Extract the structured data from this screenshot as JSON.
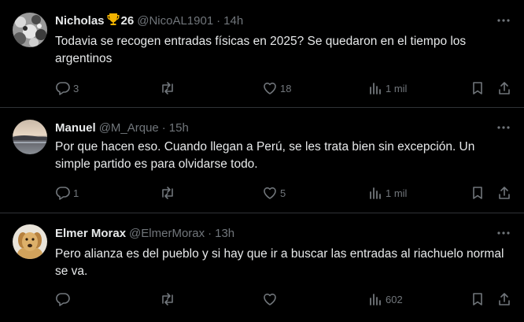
{
  "tweets": [
    {
      "name": "Nicholas",
      "name_suffix": "26",
      "trophy_icon": "trophy-emoji",
      "handle": "@NicoAL1901",
      "separator": "·",
      "time": "14h",
      "text": "Todavia se recogen entradas físicas en 2025? Se quedaron en el tiempo los argentinos",
      "replies": "3",
      "retweets": "",
      "likes": "18",
      "views": "1 mil"
    },
    {
      "name": "Manuel",
      "handle": "@M_Arque",
      "separator": "·",
      "time": "15h",
      "text": "Por que hacen eso. Cuando llegan a Perú, se les trata bien sin excepción. Un simple partido es para olvidarse todo.",
      "replies": "1",
      "retweets": "",
      "likes": "5",
      "views": "1 mil"
    },
    {
      "name": "Elmer Morax",
      "handle": "@ElmerMorax",
      "separator": "·",
      "time": "13h",
      "text": "Pero alianza es del pueblo y si hay que ir a buscar las entradas al riachuelo normal se va.",
      "replies": "",
      "retweets": "",
      "likes": "",
      "views": "602"
    }
  ],
  "colors": {
    "background": "#000000",
    "text_primary": "#e7e9ea",
    "text_secondary": "#71767b",
    "divider": "#2f3336"
  }
}
